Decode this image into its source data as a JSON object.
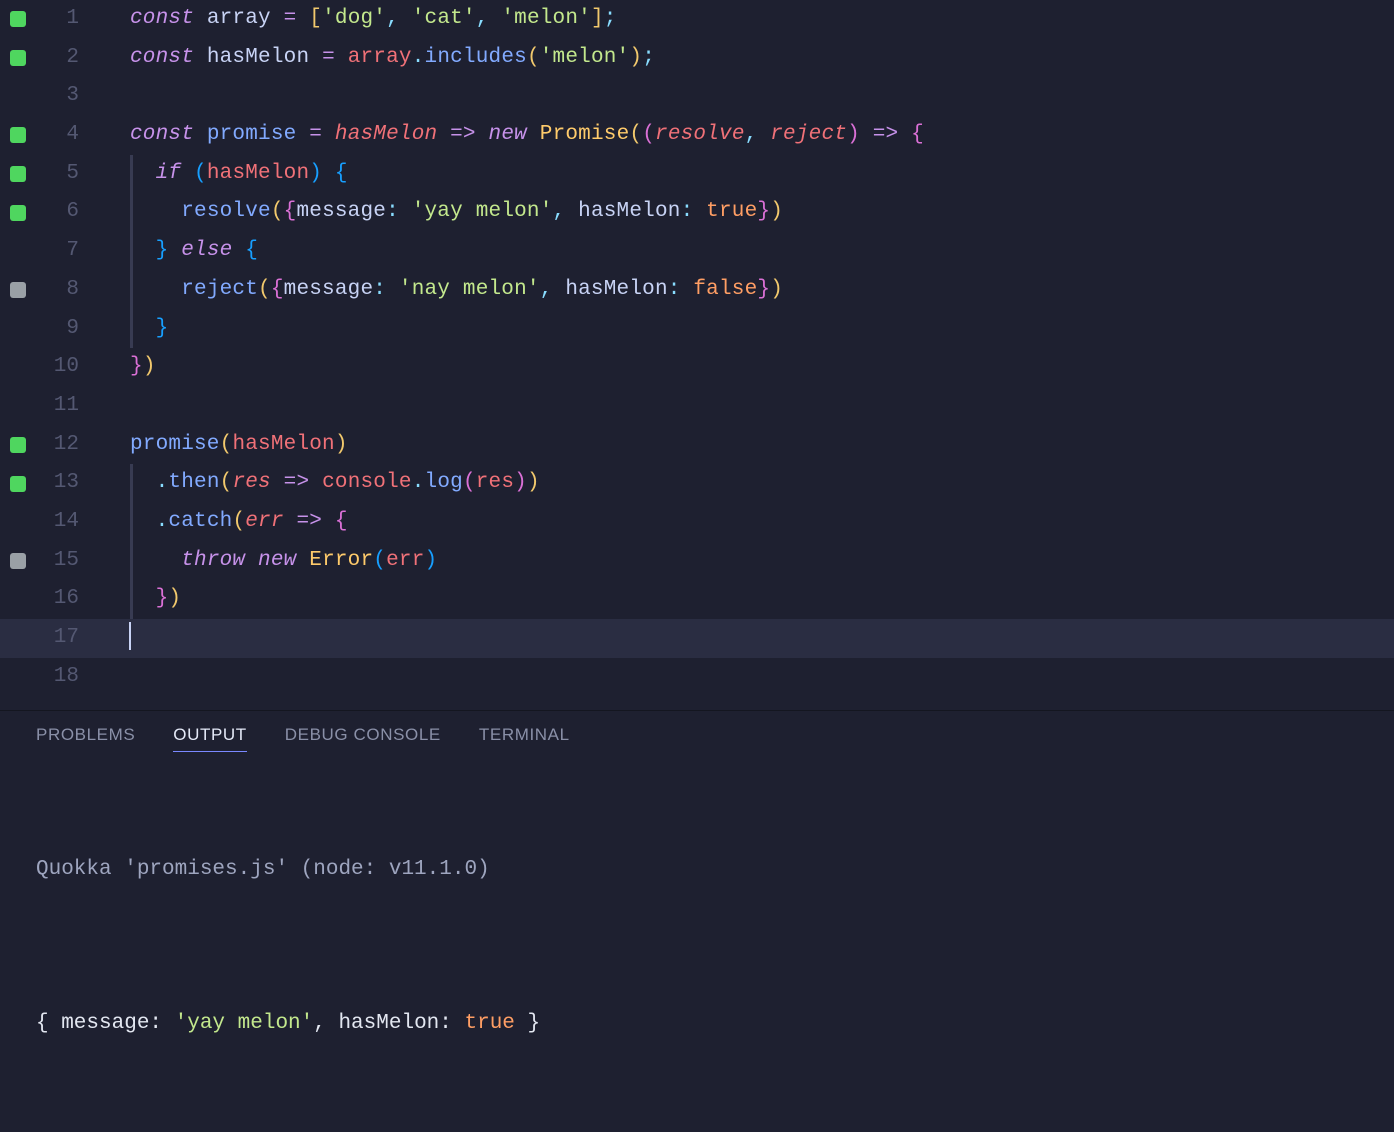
{
  "editor": {
    "activeLine": 17,
    "lines": [
      {
        "num": 1,
        "marker": "green",
        "tokens": [
          [
            "kw",
            "const"
          ],
          [
            "var",
            " "
          ],
          [
            "prop",
            "array"
          ],
          [
            "var",
            " "
          ],
          [
            "op",
            "="
          ],
          [
            "var",
            " "
          ],
          [
            "brY",
            "["
          ],
          [
            "str",
            "'dog'"
          ],
          [
            "punc",
            ", "
          ],
          [
            "str",
            "'cat'"
          ],
          [
            "punc",
            ", "
          ],
          [
            "str",
            "'melon'"
          ],
          [
            "brY",
            "]"
          ],
          [
            "punc",
            ";"
          ]
        ]
      },
      {
        "num": 2,
        "marker": "green",
        "tokens": [
          [
            "kw",
            "const"
          ],
          [
            "var",
            " "
          ],
          [
            "prop",
            "hasMelon"
          ],
          [
            "var",
            " "
          ],
          [
            "op",
            "="
          ],
          [
            "var",
            " "
          ],
          [
            "var2",
            "array"
          ],
          [
            "punc",
            "."
          ],
          [
            "fn",
            "includes"
          ],
          [
            "brY",
            "("
          ],
          [
            "str",
            "'melon'"
          ],
          [
            "brY",
            ")"
          ],
          [
            "punc",
            ";"
          ]
        ]
      },
      {
        "num": 3,
        "marker": null,
        "tokens": []
      },
      {
        "num": 4,
        "marker": "green",
        "tokens": [
          [
            "kw",
            "const"
          ],
          [
            "var",
            " "
          ],
          [
            "fn",
            "promise"
          ],
          [
            "var",
            " "
          ],
          [
            "op",
            "="
          ],
          [
            "var",
            " "
          ],
          [
            "param",
            "hasMelon"
          ],
          [
            "var",
            " "
          ],
          [
            "arrw",
            "=>"
          ],
          [
            "var",
            " "
          ],
          [
            "kw",
            "new"
          ],
          [
            "var",
            " "
          ],
          [
            "cls",
            "Promise"
          ],
          [
            "brY",
            "("
          ],
          [
            "brP",
            "("
          ],
          [
            "param",
            "resolve"
          ],
          [
            "punc",
            ", "
          ],
          [
            "param",
            "reject"
          ],
          [
            "brP",
            ")"
          ],
          [
            "var",
            " "
          ],
          [
            "arrw",
            "=>"
          ],
          [
            "var",
            " "
          ],
          [
            "brP",
            "{"
          ]
        ]
      },
      {
        "num": 5,
        "marker": "green",
        "indent": 1,
        "tokens": [
          [
            "var",
            "  "
          ],
          [
            "kw",
            "if"
          ],
          [
            "var",
            " "
          ],
          [
            "brBlue",
            "("
          ],
          [
            "var2",
            "hasMelon"
          ],
          [
            "brBlue",
            ")"
          ],
          [
            "var",
            " "
          ],
          [
            "brBlue",
            "{"
          ]
        ]
      },
      {
        "num": 6,
        "marker": "green",
        "indent": 1,
        "tokens": [
          [
            "var",
            "    "
          ],
          [
            "fn",
            "resolve"
          ],
          [
            "brY",
            "("
          ],
          [
            "brP",
            "{"
          ],
          [
            "prop",
            "message"
          ],
          [
            "punc",
            ": "
          ],
          [
            "str",
            "'yay melon'"
          ],
          [
            "punc",
            ", "
          ],
          [
            "prop",
            "hasMelon"
          ],
          [
            "punc",
            ": "
          ],
          [
            "lit",
            "true"
          ],
          [
            "brP",
            "}"
          ],
          [
            "brY",
            ")"
          ]
        ]
      },
      {
        "num": 7,
        "marker": null,
        "indent": 1,
        "tokens": [
          [
            "var",
            "  "
          ],
          [
            "brBlue",
            "}"
          ],
          [
            "var",
            " "
          ],
          [
            "kw",
            "else"
          ],
          [
            "var",
            " "
          ],
          [
            "brBlue",
            "{"
          ]
        ]
      },
      {
        "num": 8,
        "marker": "grey",
        "indent": 1,
        "tokens": [
          [
            "var",
            "    "
          ],
          [
            "fn",
            "reject"
          ],
          [
            "brY",
            "("
          ],
          [
            "brP",
            "{"
          ],
          [
            "prop",
            "message"
          ],
          [
            "punc",
            ": "
          ],
          [
            "str",
            "'nay melon'"
          ],
          [
            "punc",
            ", "
          ],
          [
            "prop",
            "hasMelon"
          ],
          [
            "punc",
            ": "
          ],
          [
            "lit",
            "false"
          ],
          [
            "brP",
            "}"
          ],
          [
            "brY",
            ")"
          ]
        ]
      },
      {
        "num": 9,
        "marker": null,
        "indent": 1,
        "tokens": [
          [
            "var",
            "  "
          ],
          [
            "brBlue",
            "}"
          ]
        ]
      },
      {
        "num": 10,
        "marker": null,
        "tokens": [
          [
            "brP",
            "}"
          ],
          [
            "brY",
            ")"
          ]
        ]
      },
      {
        "num": 11,
        "marker": null,
        "tokens": []
      },
      {
        "num": 12,
        "marker": "green",
        "tokens": [
          [
            "fn",
            "promise"
          ],
          [
            "brY",
            "("
          ],
          [
            "var2",
            "hasMelon"
          ],
          [
            "brY",
            ")"
          ]
        ]
      },
      {
        "num": 13,
        "marker": "green",
        "indent": 1,
        "tokens": [
          [
            "var",
            "  "
          ],
          [
            "punc",
            "."
          ],
          [
            "fn",
            "then"
          ],
          [
            "brY",
            "("
          ],
          [
            "param",
            "res"
          ],
          [
            "var",
            " "
          ],
          [
            "arrw",
            "=>"
          ],
          [
            "var",
            " "
          ],
          [
            "var2",
            "console"
          ],
          [
            "punc",
            "."
          ],
          [
            "fn",
            "log"
          ],
          [
            "brP",
            "("
          ],
          [
            "var2",
            "res"
          ],
          [
            "brP",
            ")"
          ],
          [
            "brY",
            ")"
          ]
        ]
      },
      {
        "num": 14,
        "marker": null,
        "indent": 1,
        "tokens": [
          [
            "var",
            "  "
          ],
          [
            "punc",
            "."
          ],
          [
            "fn",
            "catch"
          ],
          [
            "brY",
            "("
          ],
          [
            "param",
            "err"
          ],
          [
            "var",
            " "
          ],
          [
            "arrw",
            "=>"
          ],
          [
            "var",
            " "
          ],
          [
            "brP",
            "{"
          ]
        ]
      },
      {
        "num": 15,
        "marker": "grey",
        "indent": 1,
        "tokens": [
          [
            "var",
            "    "
          ],
          [
            "kw",
            "throw"
          ],
          [
            "var",
            " "
          ],
          [
            "kw",
            "new"
          ],
          [
            "var",
            " "
          ],
          [
            "cls",
            "Error"
          ],
          [
            "brBlue",
            "("
          ],
          [
            "var2",
            "err"
          ],
          [
            "brBlue",
            ")"
          ]
        ]
      },
      {
        "num": 16,
        "marker": null,
        "indent": 1,
        "tokens": [
          [
            "var",
            "  "
          ],
          [
            "brP",
            "}"
          ],
          [
            "brY",
            ")"
          ]
        ]
      },
      {
        "num": 17,
        "marker": null,
        "tokens": [],
        "cursor": true
      },
      {
        "num": 18,
        "marker": null,
        "tokens": []
      }
    ]
  },
  "panel": {
    "tabs": [
      {
        "id": "problems",
        "label": "PROBLEMS",
        "active": false
      },
      {
        "id": "output",
        "label": "OUTPUT",
        "active": true
      },
      {
        "id": "debug",
        "label": "DEBUG CONSOLE",
        "active": false
      },
      {
        "id": "terminal",
        "label": "TERMINAL",
        "active": false
      }
    ],
    "output": {
      "line1": "Quokka 'promises.js' (node: v11.1.0)",
      "line2_prefix": "{ message: ",
      "line2_string": "'yay melon'",
      "line2_mid": ", hasMelon: ",
      "line2_lit": "true",
      "line2_suffix": " }"
    }
  }
}
